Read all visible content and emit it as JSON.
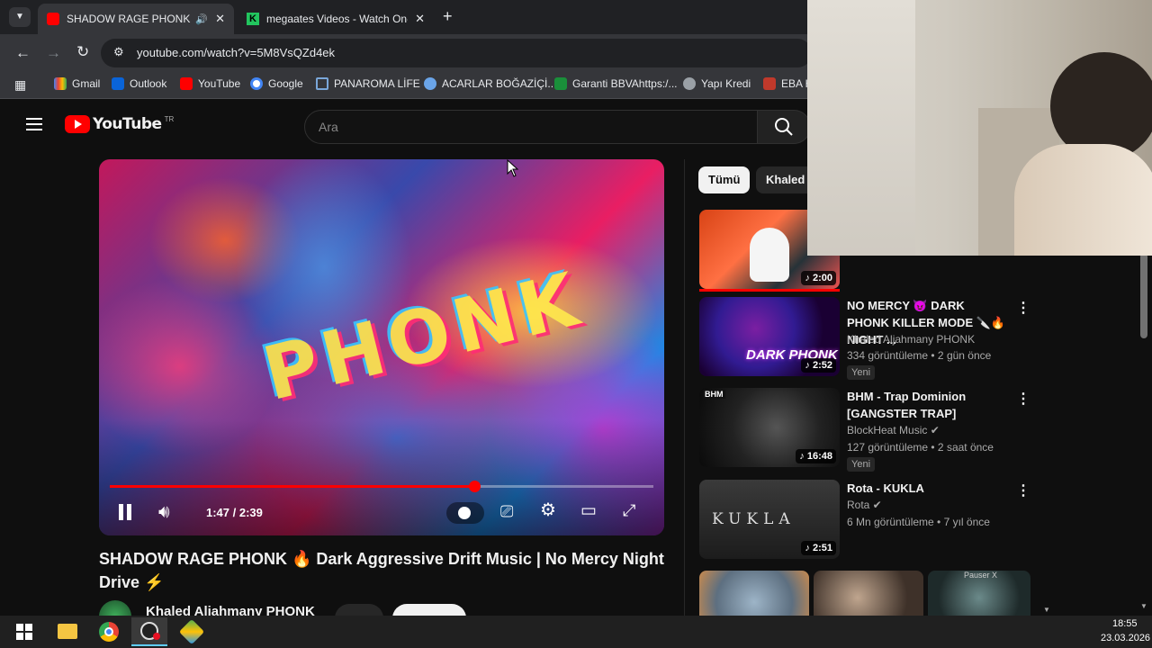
{
  "tabs": [
    {
      "title": "SHADOW RAGE PHONK 🔥",
      "active": true
    },
    {
      "title": "megaates Videos - Watch On-D",
      "active": false
    }
  ],
  "toolbar": {
    "url": "youtube.com/watch?v=5M8VsQZd4ek"
  },
  "bookmarks": [
    "Gmail",
    "Outlook",
    "YouTube",
    "Google",
    "PANAROMA LİFE",
    "ACARLAR BOĞAZİÇİ...",
    "Garanti BBVAhttps:/...",
    "Yapı Kredi",
    "EBA H"
  ],
  "youtube": {
    "logo_text": "YouTube",
    "country": "TR",
    "search_placeholder": "Ara"
  },
  "player": {
    "overlay_text": "PHONK",
    "time": "1:47 / 2:39",
    "progress": 0.67
  },
  "video": {
    "title": "SHADOW RAGE PHONK 🔥 Dark Aggressive Drift Music | No Mercy Night Drive ⚡",
    "channel": "Khaled Aljahmany PHONK"
  },
  "chips": [
    "Tümü",
    "Khaled"
  ],
  "recommendations": [
    {
      "title": "",
      "channel": "",
      "meta": "",
      "duration": "2:00",
      "badge": ""
    },
    {
      "title": "NO MERCY 😈 DARK PHONK KILLER MODE 🔪🔥 NIGHT ...",
      "channel": "Khaled Aljahmany PHONK",
      "meta": "334 görüntüleme • 2 gün önce",
      "duration": "2:52",
      "badge": "Yeni",
      "thumb_text": "DARK PHONK"
    },
    {
      "title": "BHM - Trap Dominion [GANGSTER TRAP]",
      "channel": "BlockHeat Music ✔",
      "meta": "127 görüntüleme • 2 saat önce",
      "duration": "16:48",
      "badge": "Yeni",
      "thumb_text": "BHM"
    },
    {
      "title": "Rota - KUKLA",
      "channel": "Rota ✔",
      "meta": "6 Mn görüntüleme • 7 yıl önce",
      "duration": "2:51",
      "badge": "",
      "thumb_text": "KUKLA"
    }
  ],
  "shorts_label": "Pauser X",
  "taskbar": {
    "time": "18:55",
    "date": "23.03.2026"
  },
  "colors": {
    "accent": "#ff0000",
    "bg": "#0f0f0f",
    "chrome": "#35363a"
  }
}
